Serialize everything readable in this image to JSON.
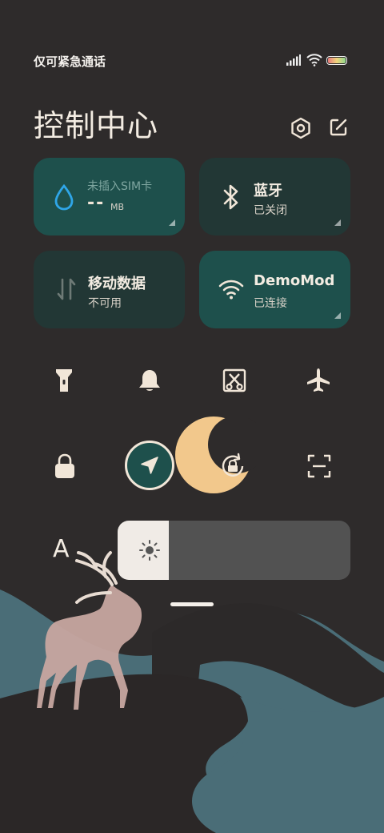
{
  "status_bar": {
    "carrier_text": "仅可紧急通话",
    "icons": [
      "signal-icon",
      "wifi-icon",
      "battery-icon"
    ]
  },
  "header": {
    "title": "控制中心",
    "icons": [
      "settings-icon",
      "edit-icon"
    ]
  },
  "tiles": {
    "sim": {
      "title": "未插入SIM卡",
      "value": "--",
      "unit": "MB",
      "active": true
    },
    "bluetooth": {
      "title": "蓝牙",
      "status": "已关闭",
      "active": false
    },
    "mobile_data": {
      "title": "移动数据",
      "status": "不可用",
      "active": false
    },
    "wifi": {
      "title": "DemoMod",
      "status": "已连接",
      "active": true
    }
  },
  "quick_icons_row1": [
    "flashlight-icon",
    "bell-icon",
    "screenshot-icon",
    "airplane-icon"
  ],
  "quick_icons_row2": [
    "lock-icon",
    "location-icon",
    "dark-mode-icon",
    "rotation-lock-icon",
    "scan-icon"
  ],
  "brightness": {
    "level_percent": 22,
    "icon": "sun-icon"
  },
  "font_size": {
    "label": "A"
  },
  "colors": {
    "background": "#2e2b2b",
    "tile_active": "#1e504c",
    "tile_inactive": "#223735",
    "accent_cream": "#f1e6d8",
    "moon": "#f2c88c",
    "hill_teal": "#4d6e78"
  }
}
